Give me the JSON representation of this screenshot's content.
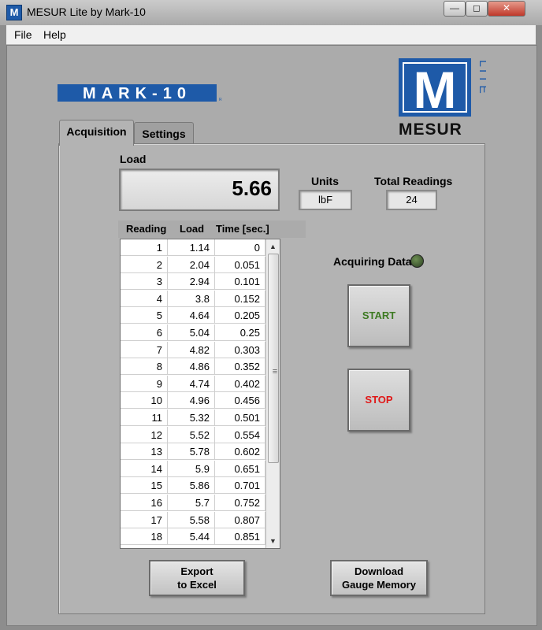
{
  "window": {
    "title": "MESUR Lite by Mark-10",
    "icon_letter": "M",
    "controls": {
      "minimize": "—",
      "maximize": "◻",
      "close": "✕"
    }
  },
  "menu": {
    "file": "File",
    "help": "Help"
  },
  "logos": {
    "brand": "MARK-10",
    "brand_mark": "R",
    "product_big": "M",
    "product_word": "MESUR",
    "product_edition": "LITE"
  },
  "tabs": {
    "acquisition": "Acquisition",
    "settings": "Settings"
  },
  "load": {
    "label": "Load",
    "value": "5.66"
  },
  "units": {
    "label": "Units",
    "value": "lbF"
  },
  "total_readings": {
    "label": "Total Readings",
    "value": "24"
  },
  "table": {
    "headers": [
      "Reading",
      "Load",
      "Time [sec.]"
    ],
    "rows": [
      [
        "1",
        "1.14",
        "0"
      ],
      [
        "2",
        "2.04",
        "0.051"
      ],
      [
        "3",
        "2.94",
        "0.101"
      ],
      [
        "4",
        "3.8",
        "0.152"
      ],
      [
        "5",
        "4.64",
        "0.205"
      ],
      [
        "6",
        "5.04",
        "0.25"
      ],
      [
        "7",
        "4.82",
        "0.303"
      ],
      [
        "8",
        "4.86",
        "0.352"
      ],
      [
        "9",
        "4.74",
        "0.402"
      ],
      [
        "10",
        "4.96",
        "0.456"
      ],
      [
        "11",
        "5.32",
        "0.501"
      ],
      [
        "12",
        "5.52",
        "0.554"
      ],
      [
        "13",
        "5.78",
        "0.602"
      ],
      [
        "14",
        "5.9",
        "0.651"
      ],
      [
        "15",
        "5.86",
        "0.701"
      ],
      [
        "16",
        "5.7",
        "0.752"
      ],
      [
        "17",
        "5.58",
        "0.807"
      ],
      [
        "18",
        "5.44",
        "0.851"
      ]
    ]
  },
  "status": {
    "acquiring_label": "Acquiring Data"
  },
  "buttons": {
    "start": "START",
    "stop": "STOP",
    "export_line1": "Export",
    "export_line2": "to Excel",
    "download_line1": "Download",
    "download_line2": "Gauge Memory"
  },
  "colors": {
    "brand_blue": "#1e5aa8",
    "start_text": "#3d7a22",
    "stop_text": "#e01818",
    "led_off": "#3f5a31"
  }
}
